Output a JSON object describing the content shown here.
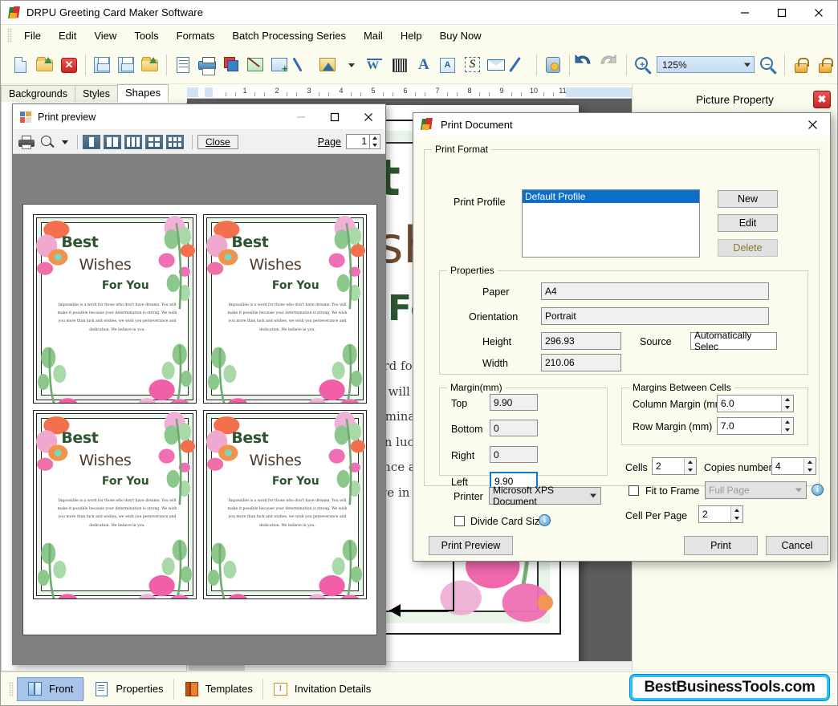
{
  "window": {
    "title": "DRPU Greeting Card Maker Software",
    "icon": "app-kite-icon",
    "controls": {
      "minimize": "—",
      "maximize": "□",
      "close": "✕"
    }
  },
  "menubar": {
    "items": [
      "File",
      "Edit",
      "View",
      "Tools",
      "Formats",
      "Batch Processing Series",
      "Mail",
      "Help",
      "Buy Now"
    ]
  },
  "toolbar": {
    "zoom_value": "125%",
    "icons": [
      "new-document-icon",
      "open-folder-icon",
      "close-document-icon",
      "save-icon",
      "save-as-icon",
      "import-folder-icon",
      "document-properties-icon",
      "print-icon",
      "card-stack-icon",
      "image-icon",
      "insert-image-icon",
      "pen-tool-icon",
      "shape-gallery-icon",
      "watermark-icon",
      "barcode-icon",
      "text-icon",
      "text-box-icon",
      "signature-icon",
      "mail-icon",
      "ruler-icon",
      "database-icon",
      "undo-icon",
      "redo-icon",
      "zoom-in-icon",
      "zoom-out-icon",
      "lock-icon",
      "unlock-icon",
      "align-left-icon",
      "flip-horizontal-icon",
      "align-right-icon",
      "align-top-icon",
      "distribute-icon",
      "align-bottom-icon"
    ]
  },
  "tabs": {
    "items": [
      {
        "label": "Backgrounds",
        "active": false
      },
      {
        "label": "Styles",
        "active": false
      },
      {
        "label": "Shapes",
        "active": true
      }
    ]
  },
  "ruler": {
    "numbers": [
      "1",
      "2",
      "3",
      "4",
      "5",
      "6",
      "7",
      "8",
      "9",
      "10",
      "11"
    ]
  },
  "canvas": {
    "card": {
      "heading_1": "Best",
      "heading_2": "Wishes",
      "heading_3": "For You",
      "body": "Impossible is a word for those who don't have dreams. You will make it possible because your determination is strong. We wish you more than luck and wishes, we wish you perseverance and dedication. We believe in you."
    }
  },
  "print_preview": {
    "title": "Print preview",
    "icon": "print-preview-icon",
    "controls": {
      "minimize": "—",
      "maximize": "□",
      "close": "✕"
    },
    "toolbar": {
      "print_icon": "print-icon",
      "zoom_icon": "magnifier-icon",
      "dropdown_icon": "chevron-down-icon",
      "page_layout_buttons": [
        "one-page-icon",
        "two-page-icon",
        "three-page-icon",
        "four-page-icon",
        "six-page-icon"
      ],
      "close_label": "Close",
      "page_label": "Page",
      "page_value": "1"
    },
    "cards": [
      {
        "heading_1": "Best",
        "heading_2": "Wishes",
        "heading_3": "For You",
        "body": "Impossible is a word for those who don't have dreams. You will make it possible because your determination is strong. We wish you more than luck and wishes, we wish you perseverance and dedication. We believe in you."
      },
      {
        "heading_1": "Best",
        "heading_2": "Wishes",
        "heading_3": "For You",
        "body": "Impossible is a word for those who don't have dreams. You will make it possible because your determination is strong. We wish you more than luck and wishes, we wish you perseverance and dedication. We believe in you."
      },
      {
        "heading_1": "Best",
        "heading_2": "Wishes",
        "heading_3": "For You",
        "body": "Impossible is a word for those who don't have dreams. You will make it possible because your determination is strong. We wish you more than luck and wishes, we wish you perseverance and dedication. We believe in you."
      },
      {
        "heading_1": "Best",
        "heading_2": "Wishes",
        "heading_3": "For You",
        "body": "Impossible is a word for those who don't have dreams. You will make it possible because your determination is strong. We wish you more than luck and wishes, we wish you perseverance and dedication. We believe in you."
      }
    ]
  },
  "print_dialog": {
    "title": "Print Document",
    "icon": "app-kite-icon",
    "close": "✕",
    "print_format": {
      "legend": "Print Format",
      "profile_label": "Print Profile",
      "profiles": [
        "Default Profile"
      ],
      "selected_profile": "Default Profile",
      "buttons": {
        "new": "New",
        "edit": "Edit",
        "delete": "Delete"
      }
    },
    "properties": {
      "legend": "Properties",
      "paper_label": "Paper",
      "paper_value": "A4",
      "orientation_label": "Orientation",
      "orientation_value": "Portrait",
      "height_label": "Height",
      "height_value": "296.93",
      "width_label": "Width",
      "width_value": "210.06",
      "source_label": "Source",
      "source_value": "Automatically Selec"
    },
    "margin": {
      "legend": "Margin(mm)",
      "top_label": "Top",
      "top_value": "9.90",
      "bottom_label": "Bottom",
      "bottom_value": "0",
      "right_label": "Right",
      "right_value": "0",
      "left_label": "Left",
      "left_value": "9.90"
    },
    "cell_margins": {
      "legend": "Margins Between Cells",
      "column_label": "Column Margin (mm)",
      "column_value": "6.0",
      "row_label": "Row Margin (mm)",
      "row_value": "7.0"
    },
    "cells_label": "Cells",
    "cells_value": "2",
    "copies_label": "Copies number",
    "copies_value": "4",
    "fit_to_frame_label": "Fit to Frame",
    "fit_to_frame_checked": false,
    "fit_to_frame_option": "Full Page",
    "fit_info_icon": "info-icon",
    "cell_per_page_label": "Cell Per Page",
    "cell_per_page_value": "2",
    "printer_label": "Printer",
    "printer_value": "Microsoft XPS Document",
    "divide_card_label": "Divide Card Size",
    "divide_card_checked": false,
    "divide_info_icon": "info-icon",
    "buttons": {
      "preview": "Print Preview",
      "print": "Print",
      "cancel": "Cancel"
    }
  },
  "right_panel": {
    "title": "Picture Property",
    "close_icon": "close-icon"
  },
  "bottom_bar": {
    "items": [
      {
        "label": "Front",
        "icon": "front-card-icon",
        "active": true
      },
      {
        "label": "Properties",
        "icon": "properties-icon",
        "active": false
      },
      {
        "label": "Templates",
        "icon": "templates-icon",
        "active": false
      },
      {
        "label": "Invitation Details",
        "icon": "invitation-details-icon",
        "active": false
      }
    ],
    "watermark": "BestBusinessTools.com"
  },
  "colors": {
    "chrome": "#fbfbee",
    "accent_blue": "#0b6fc9",
    "card_green": "#2c5530",
    "card_band": "#eaf6ea",
    "watermark_border": "#29c4f2"
  }
}
